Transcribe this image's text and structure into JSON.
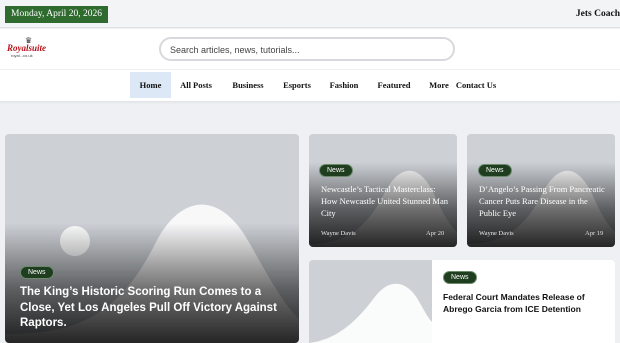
{
  "topbar": {
    "date": "Monday, April 20, 2026",
    "ticker": "Jets Coach"
  },
  "header": {
    "logo_text": "Royalsuite",
    "logo_sub": "royal...co.uk",
    "logo_crown": "♛",
    "search_placeholder": "Search articles, news, tutorials..."
  },
  "nav": {
    "items": [
      {
        "label": "Home",
        "active": true
      },
      {
        "label": "All Posts"
      },
      {
        "label": "Business"
      },
      {
        "label": "Esports"
      },
      {
        "label": "Fashion"
      },
      {
        "label": "Featured"
      },
      {
        "label": "More"
      },
      {
        "label": "Contact Us"
      }
    ]
  },
  "featured": {
    "badge": "News",
    "title": "The King’s Historic Scoring Run Comes to a Close, Yet Los Angeles Pull Off Victory Against Raptors."
  },
  "cards": [
    {
      "badge": "News",
      "title": "Newcastle’s Tactical Masterclass: How Newcastle United Stunned Man City",
      "author": "Wayne Davis",
      "date": "Apr 20"
    },
    {
      "badge": "News",
      "title": "D’Angelo’s Passing From Pancreatic Cancer Puts Rare Disease in the Public Eye",
      "author": "Wayne Davis",
      "date": "Apr 19"
    }
  ],
  "list_item": {
    "badge": "News",
    "title": "Federal Court Mandates Release of Abrego Garcia from ICE Detention"
  },
  "colors": {
    "date_badge": "#2f6b2f",
    "nav_active": "#dde8f6",
    "badge_bg": "#1f3d1f",
    "logo_red": "#b5121b"
  }
}
